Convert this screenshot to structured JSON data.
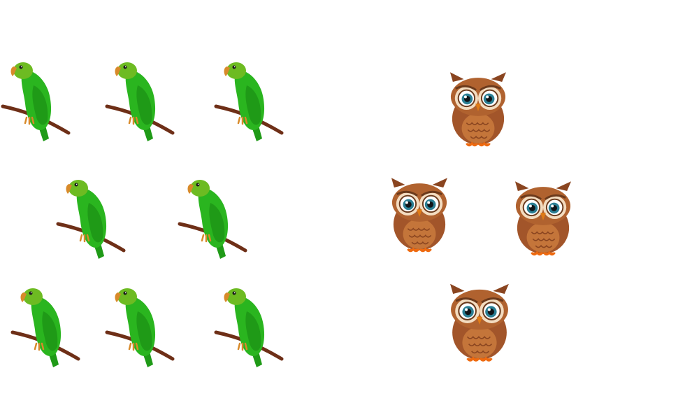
{
  "scene": {
    "parrot_group": {
      "icon": "parrot-icon",
      "count": 8,
      "colors": {
        "body": "#2ab51f",
        "head": "#6dbb22",
        "wing": "#1f9a17",
        "beak": "#d88a2a",
        "branch": "#6e2f17"
      }
    },
    "owl_group": {
      "icon": "owl-icon",
      "count": 4,
      "colors": {
        "body": "#a2552a",
        "face": "#f3dcc0",
        "iris": "#2a7e93",
        "beak": "#e07b16",
        "feet": "#ee6a10"
      }
    }
  }
}
